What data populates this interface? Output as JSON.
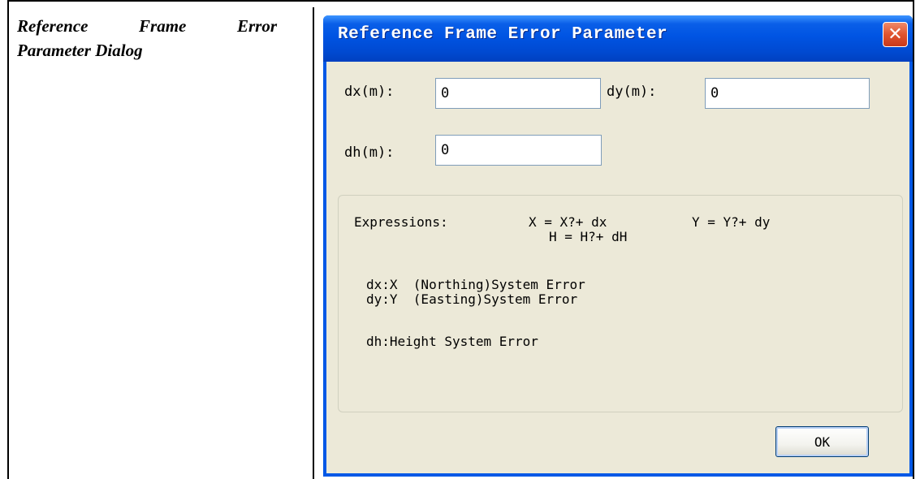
{
  "caption": {
    "line1_words": [
      "Reference",
      "Frame",
      "Error"
    ],
    "line2": "Parameter Dialog"
  },
  "dialog": {
    "title": "Reference Frame Error Parameter",
    "close_glyph": "✕",
    "fields": {
      "dx_label": "dx(m):",
      "dx_value": "0",
      "dy_label": "dy(m):",
      "dy_value": "0",
      "dh_label": "dh(m):",
      "dh_value": "0"
    },
    "expressions": {
      "heading": "Expressions:",
      "x_expr": "X = X?+ dx",
      "y_expr": "Y = Y?+ dy",
      "h_expr": "H = H?+ dH",
      "dx_desc": "dx:X  (Northing)System Error",
      "dy_desc": "dy:Y  (Easting)System Error",
      "dh_desc": "dh:Height System Error"
    },
    "ok_label": "OK"
  },
  "colors": {
    "titlebar": "#0054e3",
    "client_bg": "#ece9d8",
    "close_button": "#e0532e"
  }
}
